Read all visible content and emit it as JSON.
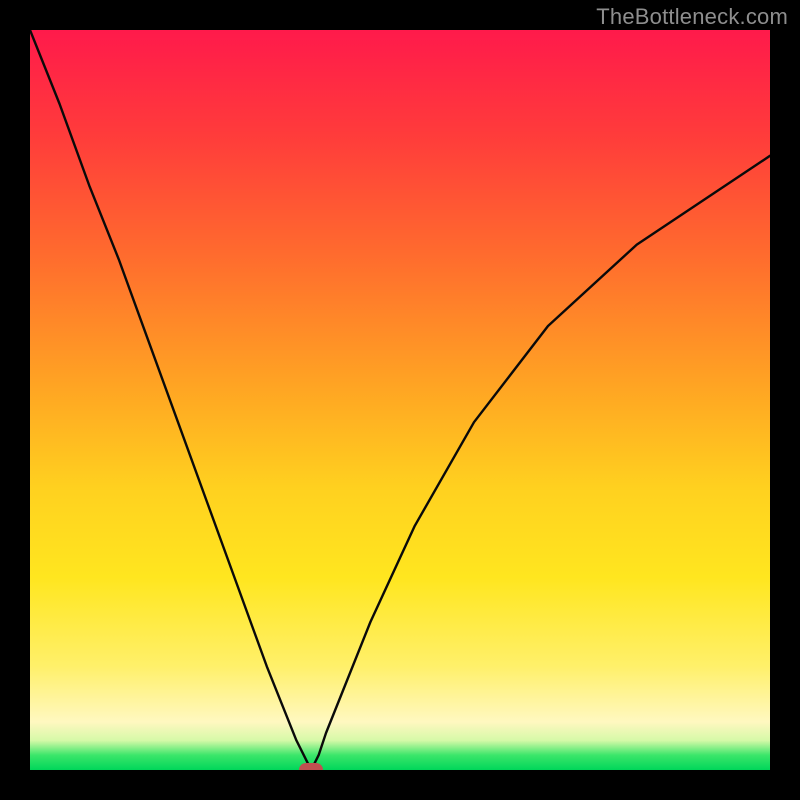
{
  "watermark": "TheBottleneck.com",
  "chart_data": {
    "type": "line",
    "title": "",
    "xlabel": "",
    "ylabel": "",
    "xlim": [
      0,
      100
    ],
    "ylim": [
      0,
      100
    ],
    "min_point": {
      "x": 38,
      "y": 0
    },
    "series": [
      {
        "name": "bottleneck-curve",
        "x": [
          0,
          4,
          8,
          12,
          16,
          20,
          24,
          28,
          32,
          34,
          36,
          37,
          38,
          39,
          40,
          42,
          46,
          52,
          60,
          70,
          82,
          100
        ],
        "values": [
          100,
          90,
          79,
          69,
          58,
          47,
          36,
          25,
          14,
          9,
          4,
          2,
          0,
          2,
          5,
          10,
          20,
          33,
          47,
          60,
          71,
          83
        ]
      }
    ],
    "marker": {
      "x": 38,
      "y": 0,
      "color": "#c05050"
    }
  }
}
